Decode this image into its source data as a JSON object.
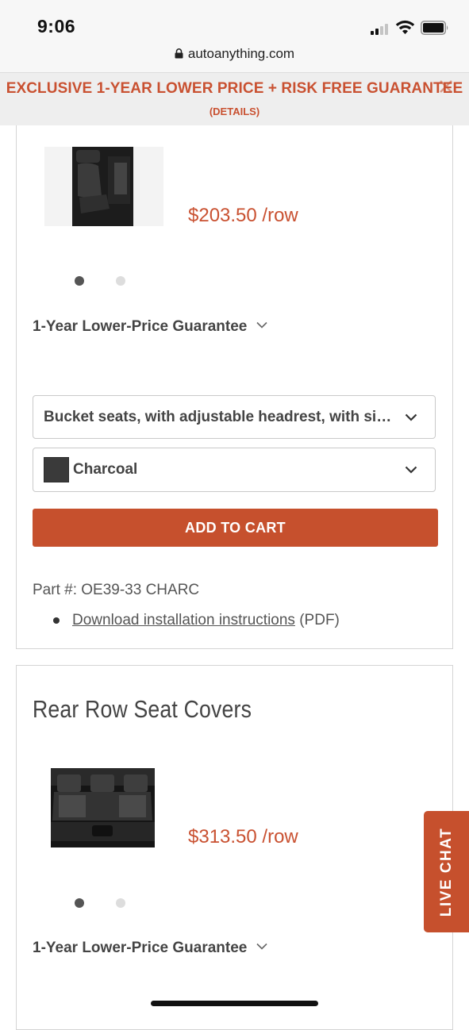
{
  "status_bar": {
    "time": "9:06"
  },
  "browser": {
    "url": "autoanything.com"
  },
  "promo": {
    "title": "EXCLUSIVE 1-YEAR LOWER PRICE + RISK FREE GUARANTEE",
    "details": "(DETAILS)"
  },
  "product1": {
    "price": "$203.50 /row",
    "guarantee": "1-Year Lower-Price Guarantee",
    "seat_option": "Bucket seats, with adjustable headrest, with side airbag",
    "color_option": "Charcoal",
    "add_to_cart": "ADD TO CART",
    "part_number": "Part #: OE39-33 CHARC",
    "download_link": "Download installation instructions",
    "download_suffix": "(PDF)",
    "carousel_active": 1,
    "carousel_count": 2
  },
  "product2": {
    "section_title": "Rear Row Seat Covers",
    "price": "$313.50 /row",
    "guarantee": "1-Year Lower-Price Guarantee",
    "carousel_active": 1,
    "carousel_count": 2
  },
  "live_chat": {
    "label": "LIVE CHAT"
  },
  "colors": {
    "accent": "#c6502d",
    "promo_text": "#c95131",
    "price": "#c95131"
  }
}
